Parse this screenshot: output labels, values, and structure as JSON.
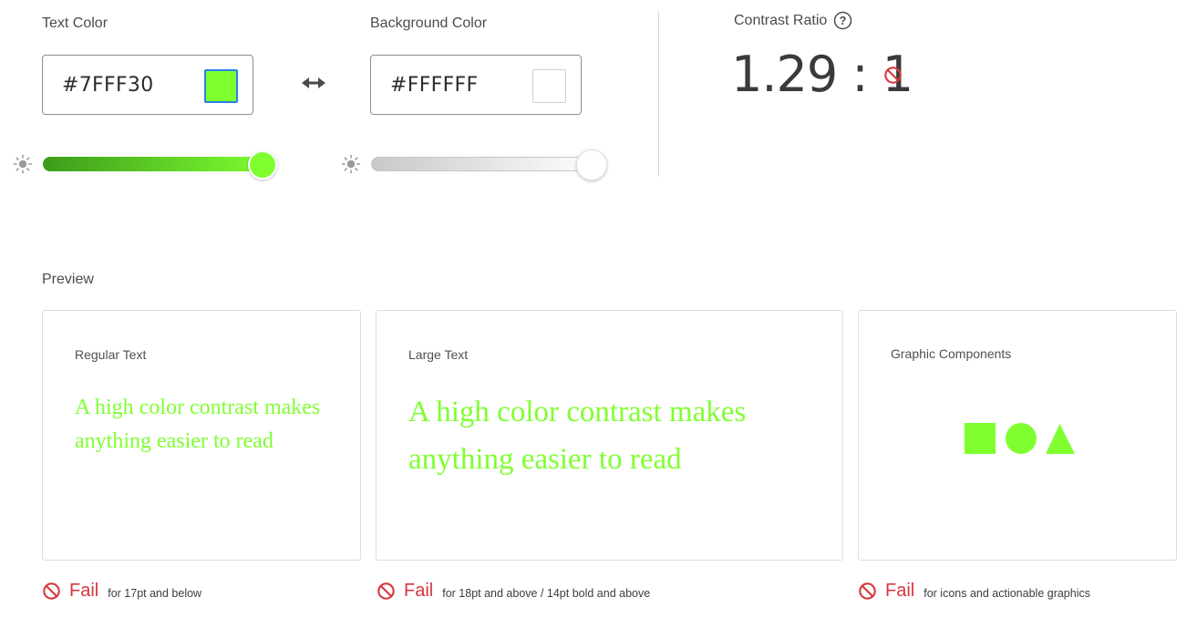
{
  "text_color": {
    "label": "Text Color",
    "value": "#7FFF30",
    "swatch_color": "#7FFF30",
    "slider_start_color": "#3c9b1a",
    "slider_end_color": "#7FFF30",
    "brightness": 1.0
  },
  "swap_icon": "swap-arrows-icon",
  "background_color": {
    "label": "Background Color",
    "value": "#FFFFFF",
    "swatch_color": "#FFFFFF",
    "slider_start_color": "#c8c8c8",
    "slider_end_color": "#FFFFFF",
    "brightness": 1.0
  },
  "contrast": {
    "label": "Contrast Ratio",
    "help_icon": "question-circle-icon",
    "ratio": "1.29 : 1",
    "status_icon": "fail-circle-icon"
  },
  "preview": {
    "label": "Preview",
    "regular": {
      "title": "Regular Text",
      "sample": "A high color contrast makes anything easier to read",
      "result": "Fail",
      "desc": "for 17pt and below"
    },
    "large": {
      "title": "Large Text",
      "sample": "A high color contrast makes anything easier to read",
      "result": "Fail",
      "desc": "for 18pt and above / 14pt bold and above"
    },
    "graphics": {
      "title": "Graphic Components",
      "shapes": [
        "square",
        "circle",
        "triangle"
      ],
      "result": "Fail",
      "desc": "for icons and actionable graphics"
    }
  },
  "colors": {
    "fail_red": "#d7373f",
    "accent_blue": "#2680eb",
    "sample_fg": "#7FFF30"
  }
}
